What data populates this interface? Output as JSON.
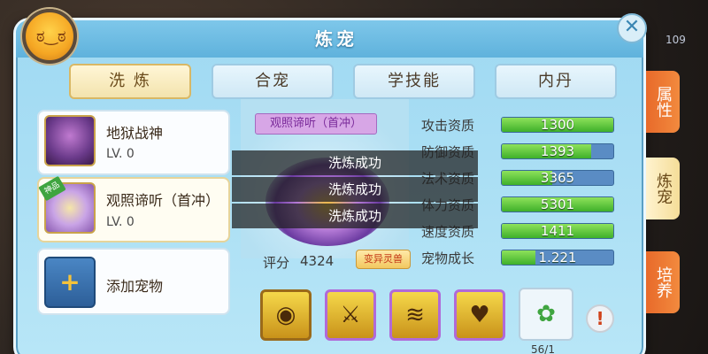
{
  "window": {
    "title": "炼宠",
    "side_level": "109"
  },
  "tabs": [
    {
      "label": "洗 炼",
      "active": true
    },
    {
      "label": "合宠",
      "active": false
    },
    {
      "label": "学技能",
      "active": false
    },
    {
      "label": "内丹",
      "active": false
    }
  ],
  "pets": [
    {
      "name": "地狱战神",
      "level": "LV. 0",
      "selected": false
    },
    {
      "name": "观照谛听（首冲）",
      "level": "LV. 0",
      "selected": true,
      "badge": "神品"
    }
  ],
  "add_pet": {
    "label": "添加宠物"
  },
  "preview": {
    "pet_title": "观照谛听（首冲）",
    "score_label": "评分",
    "score_value": "4324",
    "mutate_button": "变异灵兽"
  },
  "stats": [
    {
      "label": "攻击资质",
      "value": "1300",
      "fill": 1.0
    },
    {
      "label": "防御资质",
      "value": "1393",
      "fill": 0.8
    },
    {
      "label": "法术资质",
      "value": "3365",
      "fill": 0.45
    },
    {
      "label": "体力资质",
      "value": "5301",
      "fill": 1.0
    },
    {
      "label": "速度资质",
      "value": "1411",
      "fill": 1.0
    },
    {
      "label": "宠物成长",
      "value": "1.221",
      "fill": 0.3
    }
  ],
  "toasts": [
    "洗炼成功",
    "洗炼成功",
    "洗炼成功"
  ],
  "skills": [
    {
      "icon": "eye-skill-icon",
      "glyph": "◉"
    },
    {
      "icon": "claw-skill-icon",
      "glyph": "⚔"
    },
    {
      "icon": "wave-skill-icon",
      "glyph": "≋"
    },
    {
      "icon": "heart-skill-icon",
      "glyph": "♥"
    }
  ],
  "item": {
    "icon": "potion-icon",
    "glyph": "✿",
    "count": "56/1"
  },
  "side_tabs": [
    {
      "label": "属性",
      "active": false
    },
    {
      "label": "炼宠",
      "active": true
    },
    {
      "label": "培养",
      "active": false
    }
  ]
}
